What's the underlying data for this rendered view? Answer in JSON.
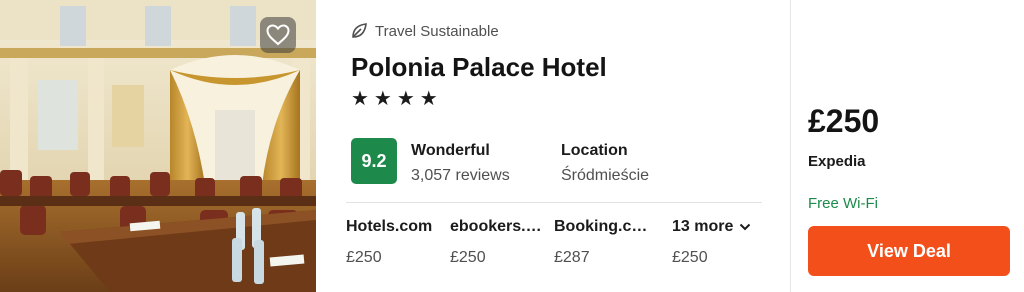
{
  "photo": {
    "alt_icon": "hotel-ballroom-photo",
    "favorite_icon": "heart-icon"
  },
  "badge": {
    "icon": "leaf-icon",
    "text": "Travel Sustainable"
  },
  "hotel": {
    "name": "Polonia Palace Hotel",
    "stars_text": "★★★★",
    "star_count": 4
  },
  "rating": {
    "score": "9.2",
    "label": "Wonderful",
    "reviews": "3,057 reviews"
  },
  "location": {
    "title": "Location",
    "value": "Śródmieście"
  },
  "providers": [
    {
      "name": "Hotels.com",
      "price": "£250"
    },
    {
      "name": "ebookers.com",
      "price": "£250"
    },
    {
      "name": "Booking.com",
      "price": "£287"
    }
  ],
  "more": {
    "label": "13 more",
    "icon": "chevron-down-icon",
    "price": "£250"
  },
  "deal": {
    "price": "£250",
    "provider": "Expedia",
    "amenity": "Free Wi-Fi",
    "button_label": "View Deal"
  },
  "colors": {
    "score_green": "#1d8a4b",
    "cta_orange": "#f24f1a",
    "wifi_green": "#1d8a4b"
  }
}
